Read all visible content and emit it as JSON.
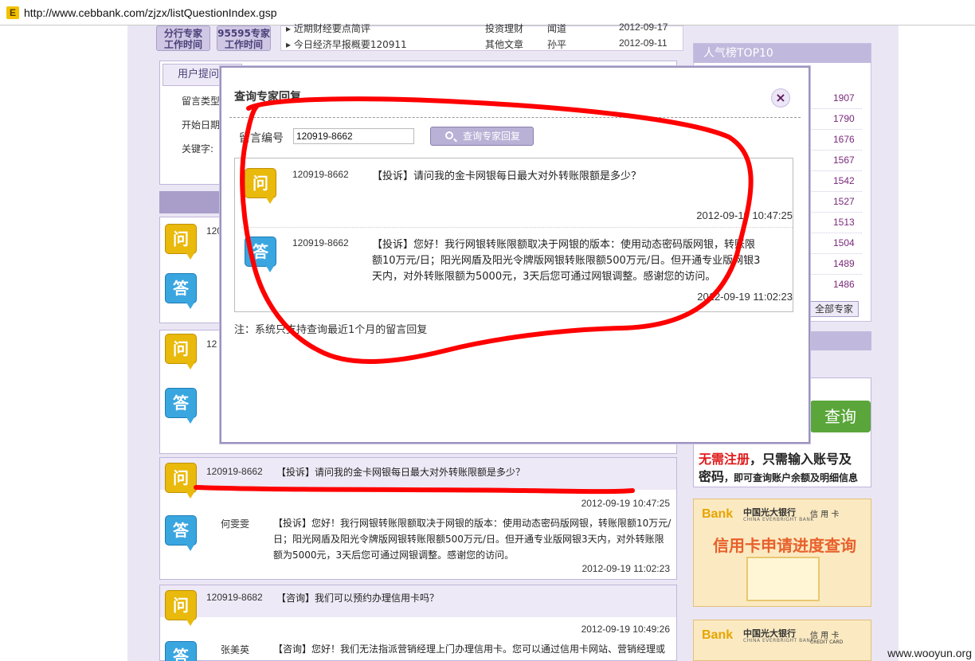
{
  "browser": {
    "url": "http://www.cebbank.com/zjzx/listQuestionIndex.gsp",
    "favicon_letter": "E"
  },
  "top_blocks": {
    "btn1": "分行专家\n工作时间",
    "btn2": "95595专家\n工作时间"
  },
  "news": [
    {
      "title": "近期财经要点简评",
      "category": "投资理财",
      "author": "闻道",
      "date": "2012-09-17"
    },
    {
      "title": "今日经济早报概要120911",
      "category": "其他文章",
      "author": "孙平",
      "date": "2012-09-11"
    }
  ],
  "search_form": {
    "tab": "用户提问",
    "type_label": "留言类型",
    "start_label": "开始日期",
    "keyword_label": "关键字:"
  },
  "top10": {
    "title": "人气榜TOP10",
    "values": [
      "1907",
      "1790",
      "1676",
      "1567",
      "1542",
      "1527",
      "1513",
      "1504",
      "1489",
      "1486"
    ],
    "all_button": "全部专家"
  },
  "ads": {
    "query_badge": "查询",
    "line1_red": "无需注册",
    "line1_rest": "，只需输入账号及",
    "line2_big": "密码",
    "line2_small": "，即可查询账户余额及明细信息",
    "logo_text": "Bank",
    "bank_cn": "中国光大银行",
    "bank_en": "CHINA EVERBRIGHT BANK",
    "card_label": "信 用 卡",
    "card_label_en": "CREDIT CARD",
    "card_title": "信用卡申请进度查询"
  },
  "list": [
    {
      "id": "120919-8662",
      "question": "【投诉】请问我的金卡网银每日最大对外转账限额是多少？",
      "q_time": "2012-09-19 10:47:25",
      "answerer": "何雯雯",
      "answer": "【投诉】您好！我行网银转账限额取决于网银的版本：使用动态密码版网银，转账限额10万元/日；阳光网盾及阳光令牌版网银转账限额500万元/日。但开通专业版网银3天内，对外转账限额为5000元，3天后您可通过网银调整。感谢您的访问。",
      "a_time": "2012-09-19 11:02:23"
    },
    {
      "id": "120919-8682",
      "question": "【咨询】我们可以预约办理信用卡吗？",
      "q_time": "2012-09-19 10:49:26",
      "answerer": "张美英",
      "answer": "【咨询】您好！我们无法指派营销经理上门办理信用卡。您可以通过信用卡网站、营销经理或"
    }
  ],
  "partial_ids": [
    "120",
    "12"
  ],
  "icons": {
    "question": "问",
    "answer": "答"
  },
  "modal": {
    "title": "查询专家回复",
    "close": "×",
    "no_label": "留言编号",
    "no_value": "120919-8662",
    "button": "查询专家回复",
    "result": {
      "q_id": "120919-8662",
      "q_text": "【投诉】请问我的金卡网银每日最大对外转账限额是多少？",
      "q_time": "2012-09-19 10:47:25",
      "a_id": "120919-8662",
      "a_line1": "【投诉】您好！我行网银转账限额取决于网银的版本：使用动态密码版网银，转账限",
      "a_line2": "额10万元/日；阳光网盾及阳光令牌版网银转账限额500万元/日。但开通专业版网银3",
      "a_line3": "天内，对外转账限额为5000元，3天后您可通过网银调整。感谢您的访问。",
      "a_time": "2012-09-19 11:02:23"
    },
    "note": "注：系统只支持查询最近1个月的留言回复"
  },
  "watermark": "www.wooyun.org",
  "colors": {
    "accent": "#a89ec9",
    "annotation": "#ff0000",
    "question_icon": "#e9b90b",
    "answer_icon": "#3aa6e0"
  }
}
